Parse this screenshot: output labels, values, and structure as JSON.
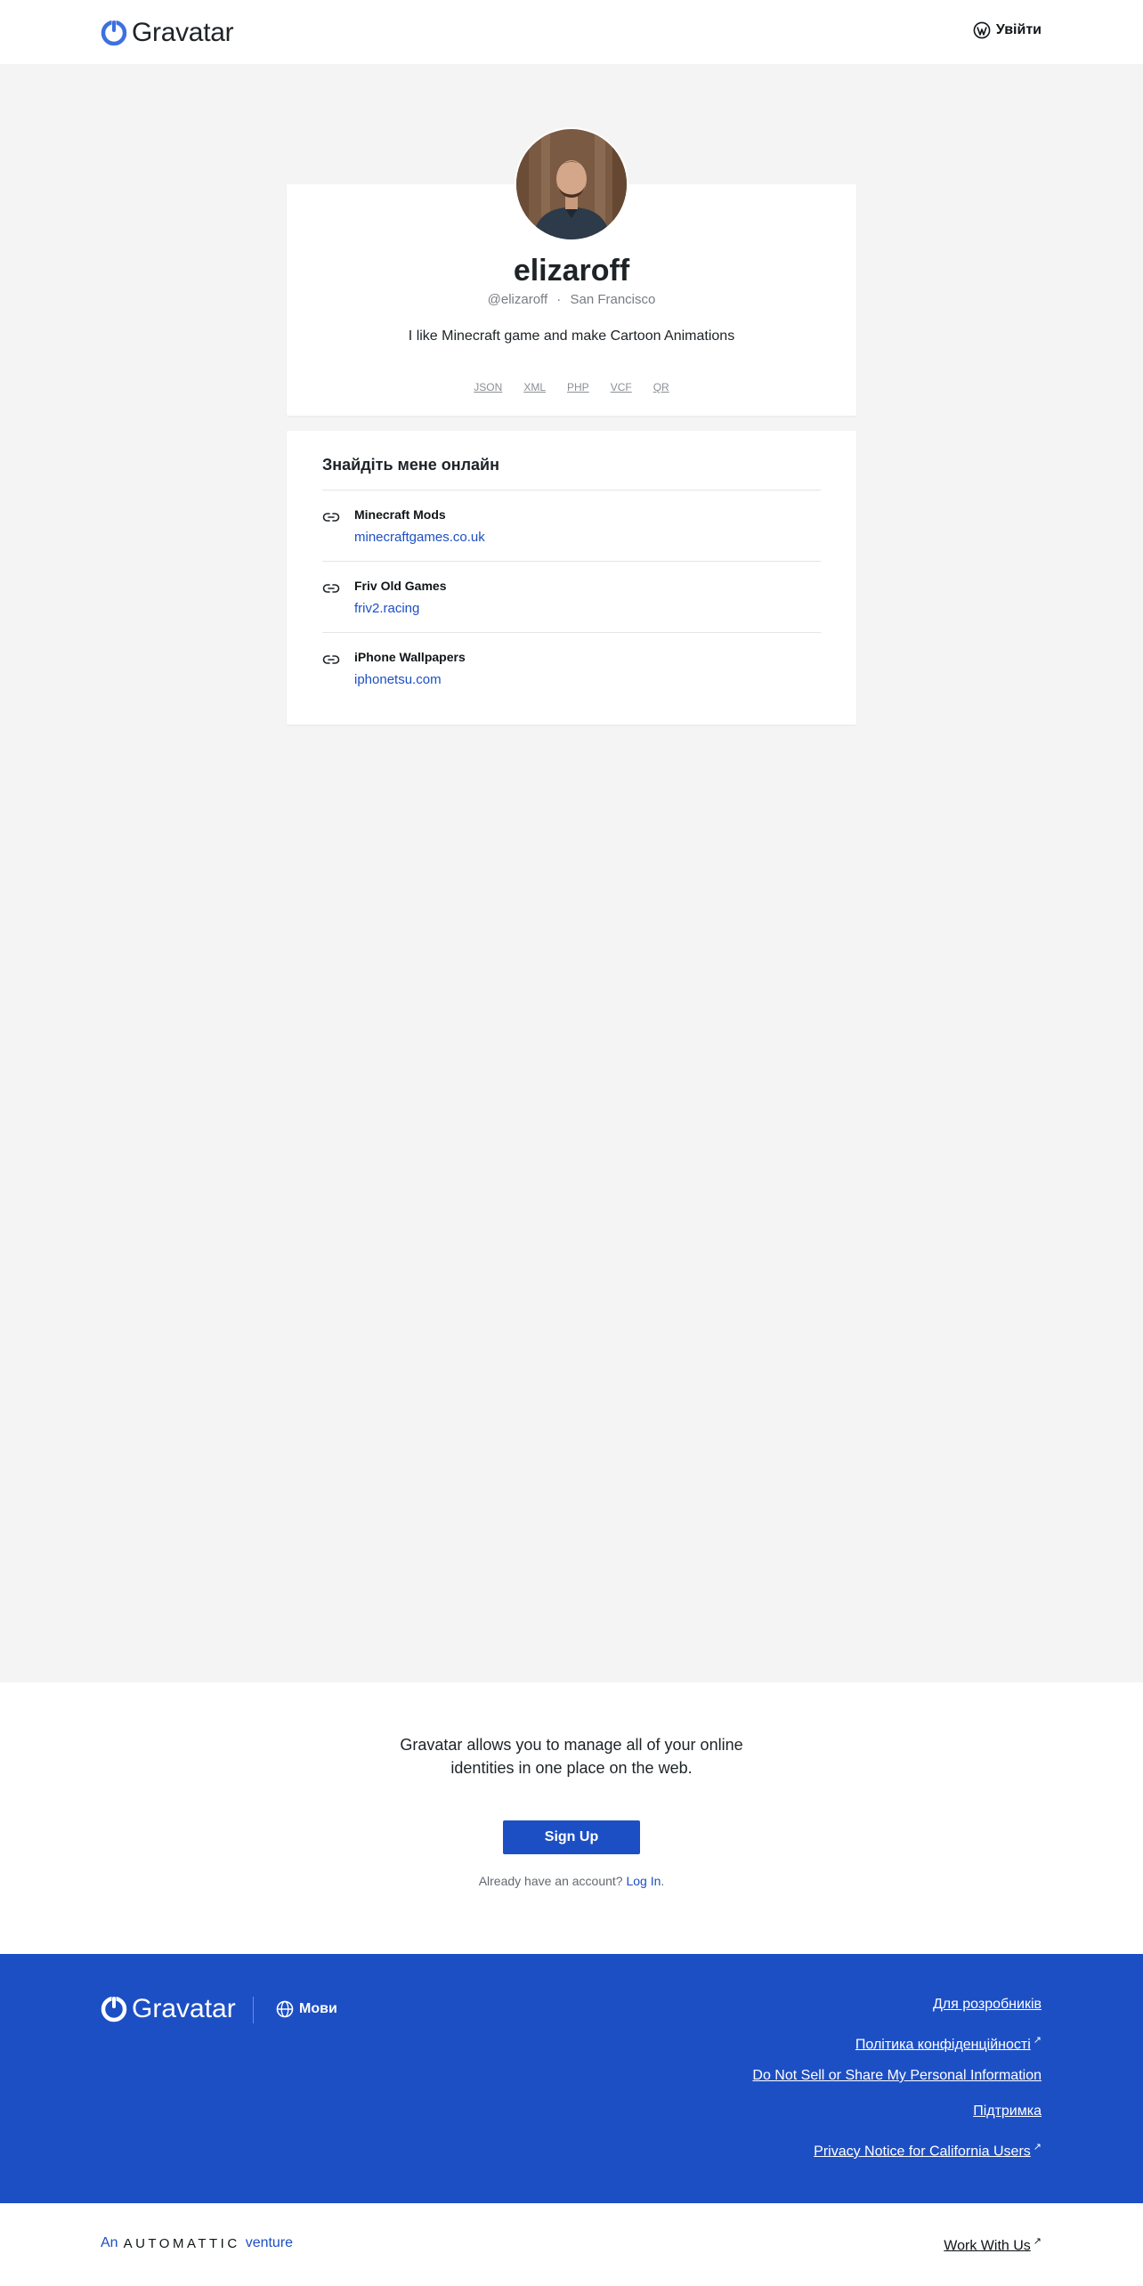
{
  "header": {
    "logo_text": "Gravatar",
    "login_label": "Увійти"
  },
  "profile": {
    "display_name": "elizaroff",
    "username": "@elizaroff",
    "separator": "·",
    "location": "San Francisco",
    "bio": "I like Minecraft game and make Cartoon Animations",
    "formats": [
      "JSON",
      "XML",
      "PHP",
      "VCF",
      "QR"
    ]
  },
  "links_section": {
    "title": "Знайдіть мене онлайн",
    "items": [
      {
        "label": "Minecraft Mods",
        "url": "minecraftgames.co.uk"
      },
      {
        "label": "Friv Old Games",
        "url": "friv2.racing"
      },
      {
        "label": "iPhone Wallpapers",
        "url": "iphonetsu.com"
      }
    ]
  },
  "cta": {
    "text": "Gravatar allows you to manage all of your online identities in one place on the web.",
    "signup_label": "Sign Up",
    "already_text": "Already have an account?",
    "login_link": "Log In",
    "period": "."
  },
  "footer": {
    "logo_text": "Gravatar",
    "languages_label": "Мови",
    "links": [
      {
        "label": "Для розробників",
        "external": false
      },
      {
        "label": "Політика конфіденційності",
        "external": true
      },
      {
        "label": "Do Not Sell or Share My Personal Information",
        "external": false
      },
      {
        "label": "Підтримка",
        "external": false
      },
      {
        "label": "Privacy Notice for California Users",
        "external": true
      }
    ],
    "external_glyph": "↗"
  },
  "bottom": {
    "an": "An",
    "automattic": "AUTOMATTIC",
    "venture": "venture",
    "work_with_us": "Work With Us"
  },
  "colors": {
    "accent": "#1d4fc4",
    "background": "#f4f4f4",
    "logo_blue": "#3d70e0"
  },
  "icons": [
    "gravatar-logo-icon",
    "wordpress-icon",
    "link-icon",
    "globe-icon",
    "external-link-icon"
  ]
}
